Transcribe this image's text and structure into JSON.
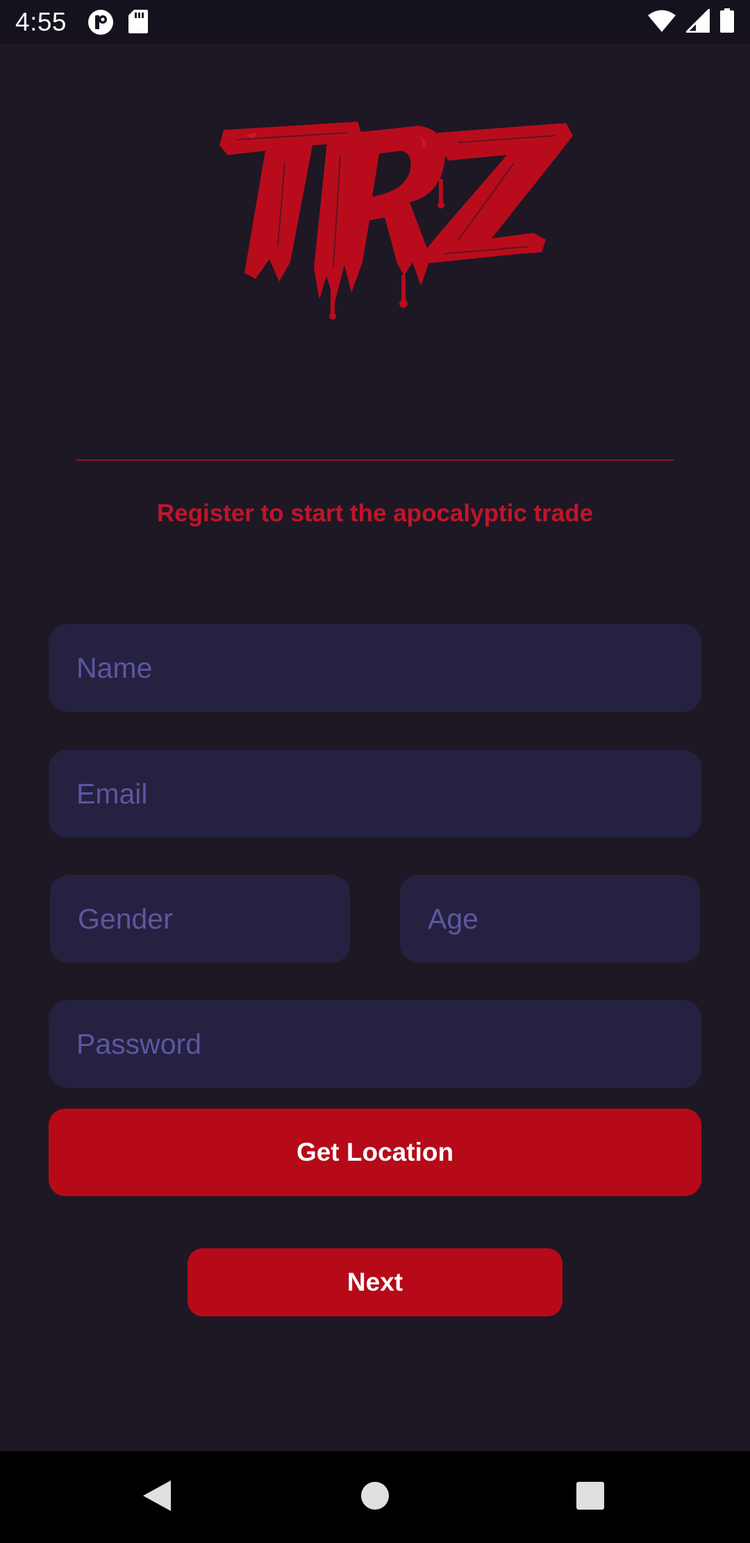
{
  "status_bar": {
    "time": "4:55",
    "icons": [
      "app-notification-icon",
      "sd-card-icon",
      "wifi-icon",
      "signal-icon",
      "battery-icon"
    ]
  },
  "logo": {
    "text": "TRZ",
    "color": "#b80c1c"
  },
  "tagline": "Register to start the apocalyptic trade",
  "form": {
    "name_placeholder": "Name",
    "email_placeholder": "Email",
    "gender_placeholder": "Gender",
    "age_placeholder": "Age",
    "password_placeholder": "Password"
  },
  "buttons": {
    "get_location": "Get Location",
    "next": "Next"
  },
  "nav_bar": {
    "icons": [
      "back-icon",
      "home-icon",
      "recents-icon"
    ]
  },
  "colors": {
    "background": "#1d1824",
    "field_background": "#252140",
    "placeholder": "#5e56a0",
    "accent": "#b60a19"
  }
}
